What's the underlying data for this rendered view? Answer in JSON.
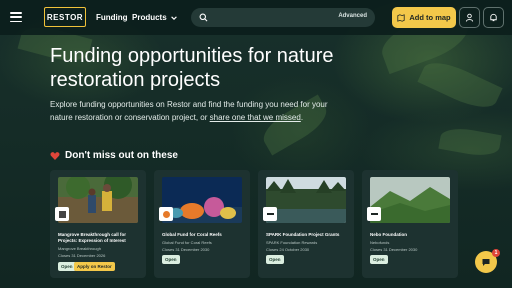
{
  "header": {
    "logo_text": "RESTOR",
    "nav_funding": "Funding",
    "nav_products": "Products",
    "search_advanced": "Advanced",
    "add_to_map": "Add to map"
  },
  "hero": {
    "title": "Funding opportunities for nature restoration projects",
    "desc_part1": "Explore funding opportunities on Restor and find the funding you need for your nature restoration or conservation project, or ",
    "desc_link": "share one that we missed",
    "desc_end": "."
  },
  "section": {
    "title": "Don't miss out on these"
  },
  "cards": [
    {
      "title": "Mangrove Breakthrough call for Projects: Expression of Interest",
      "org": "Mangrove Breakthrough",
      "closes": "Closes 31 December 2026",
      "status": "Open",
      "apply": "Apply on Restor"
    },
    {
      "title": "Global Fund for Coral Reefs",
      "org": "Global Fund for Coral Reefs",
      "closes": "Closes 31 December 2030",
      "status": "Open"
    },
    {
      "title": "SPARK Foundation Project Grants",
      "org": "SPARK Foundation Rewards",
      "closes": "Closes 24 October 2030",
      "status": "Open"
    },
    {
      "title": "Nebo Foundation",
      "org": "Nebofunds",
      "closes": "Closes 31 December 2030",
      "status": "Open"
    }
  ],
  "chat": {
    "badge": "1"
  },
  "colors": {
    "accent": "#f3c84a",
    "background": "#0f2321",
    "card": "#1d3230",
    "open_badge": "#dbeee0"
  }
}
